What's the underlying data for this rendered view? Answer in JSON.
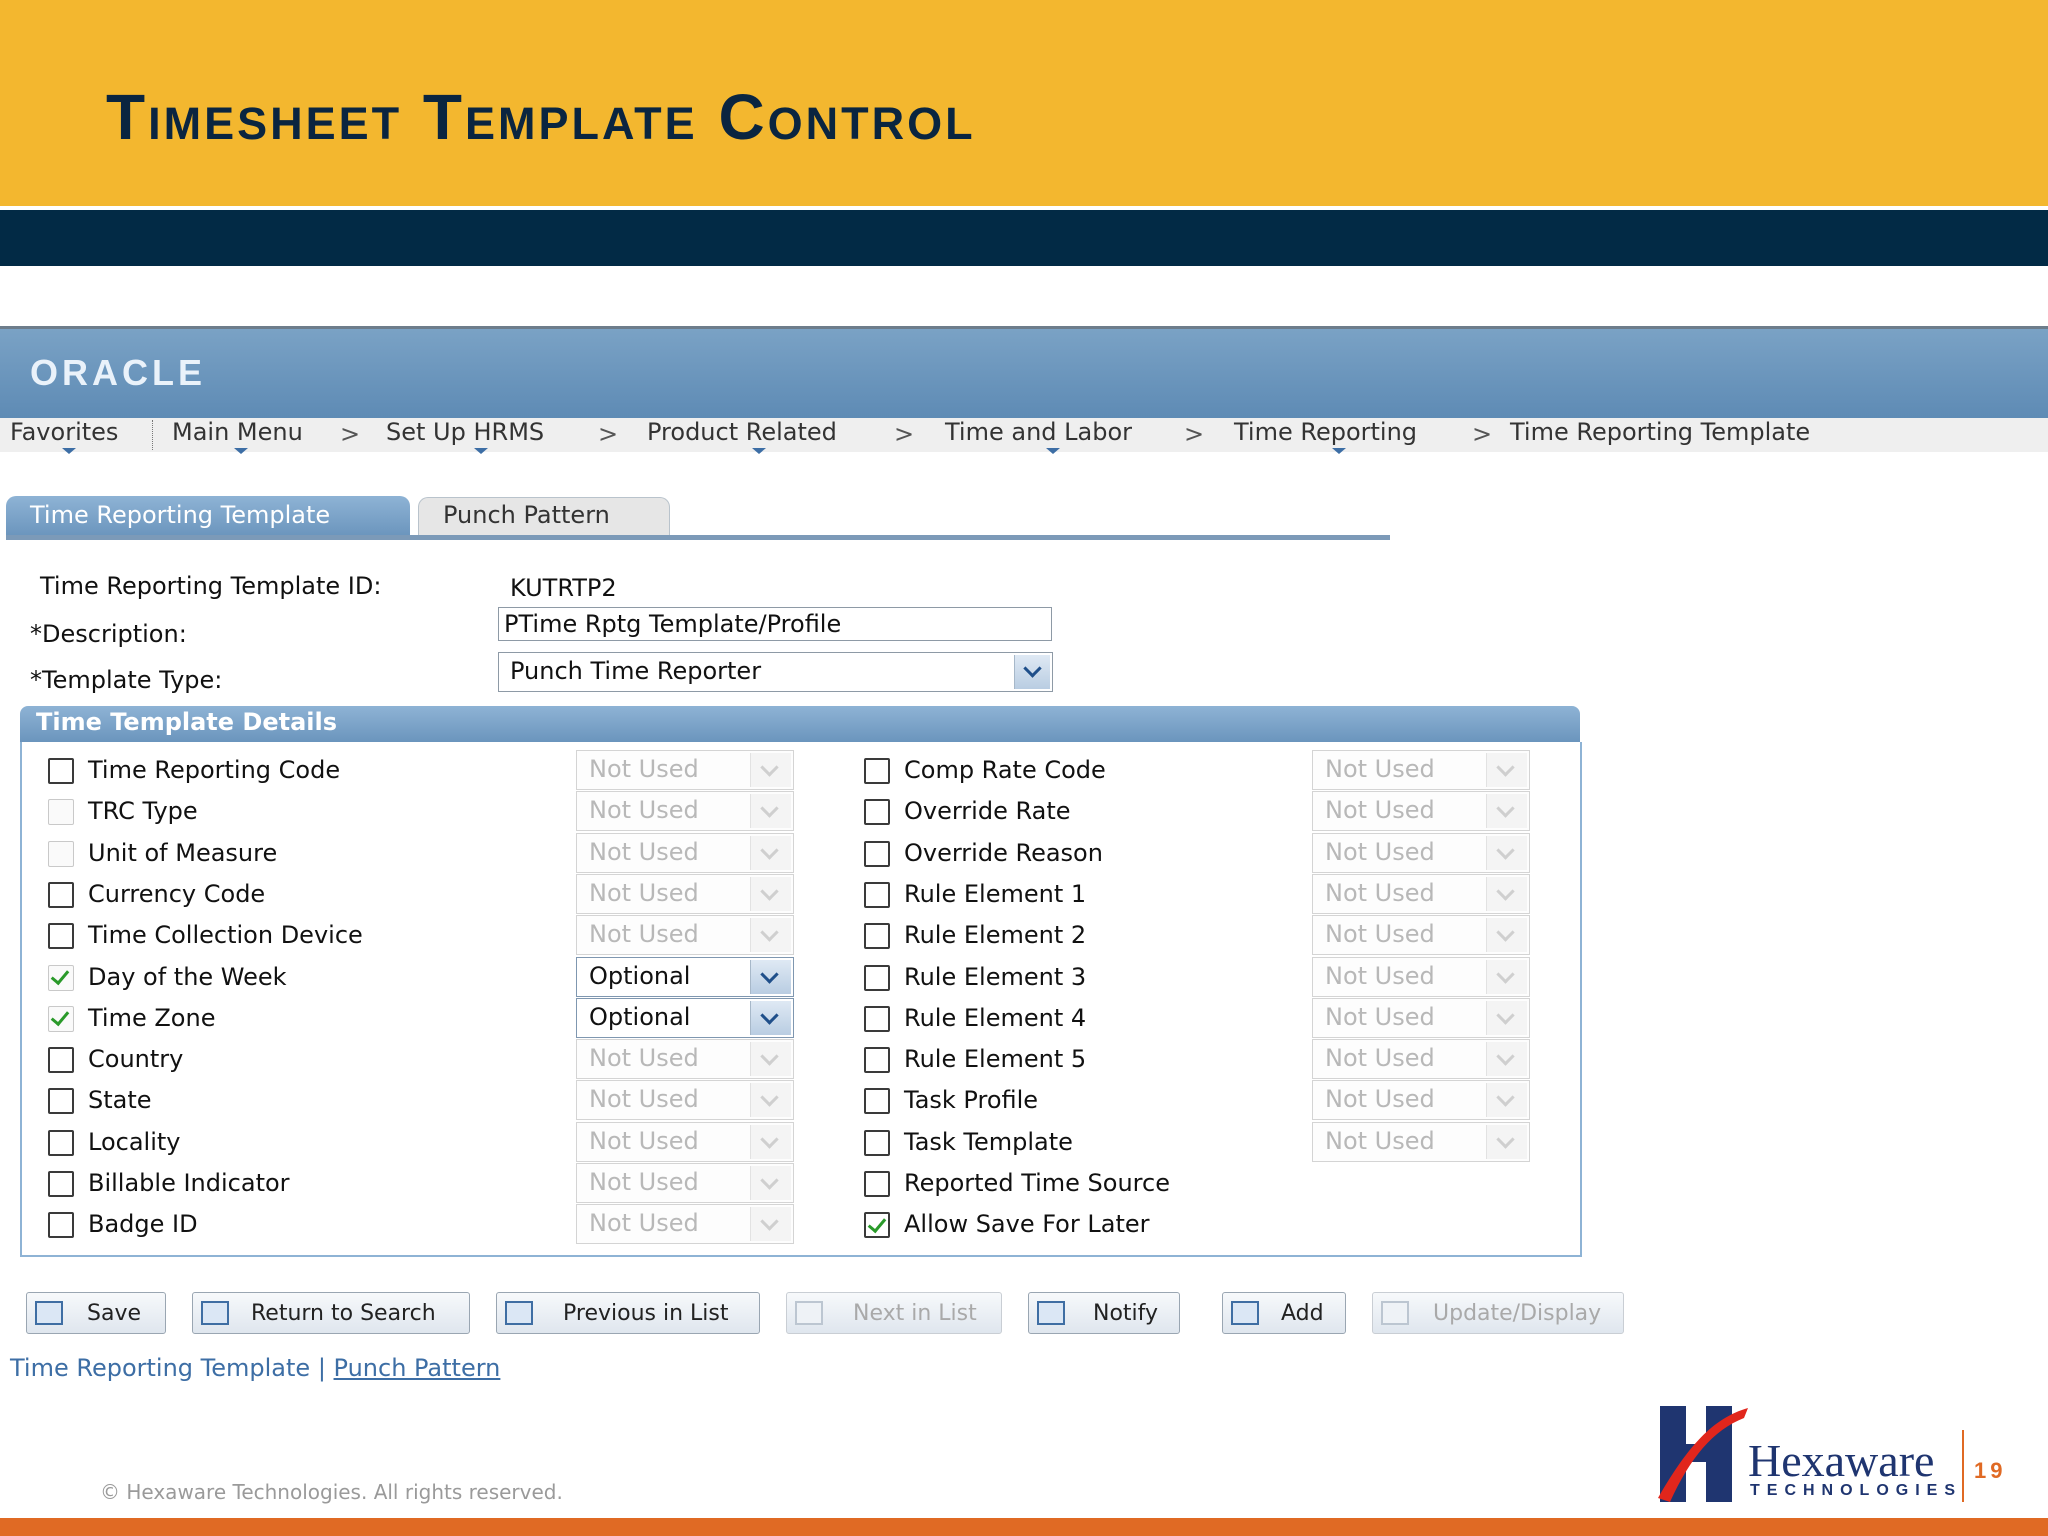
{
  "slide": {
    "title": "Timesheet Template Control",
    "copyright": "© Hexaware Technologies. All rights reserved.",
    "page_number": "19",
    "logo_name": "Hexaware",
    "logo_tagline": "TECHNOLOGIES"
  },
  "oracle": {
    "logo": "ORACLE"
  },
  "nav": {
    "items": [
      "Favorites",
      "Main Menu",
      "Set Up HRMS",
      "Product Related",
      "Time and Labor",
      "Time Reporting",
      "Time Reporting Template"
    ],
    "separator": ">"
  },
  "tabs": [
    {
      "label": "Time Reporting Template",
      "active": true
    },
    {
      "label": "Punch Pattern",
      "active": false
    }
  ],
  "form": {
    "id_label": "Time Reporting Template ID:",
    "id_value": "KUTRTP2",
    "description_label": "*Description:",
    "description_value": "PTime Rptg Template/Profile",
    "type_label": "*Template Type:",
    "type_value": "Punch Time Reporter"
  },
  "details": {
    "title": "Time Template Details",
    "left": [
      {
        "label": "Time Reporting Code",
        "checked": false,
        "disabled": false,
        "value": "Not Used",
        "enabled": false
      },
      {
        "label": "TRC Type",
        "checked": false,
        "disabled": true,
        "value": "Not Used",
        "enabled": false
      },
      {
        "label": "Unit of Measure",
        "checked": false,
        "disabled": true,
        "value": "Not Used",
        "enabled": false
      },
      {
        "label": "Currency Code",
        "checked": false,
        "disabled": false,
        "value": "Not Used",
        "enabled": false
      },
      {
        "label": "Time Collection Device",
        "checked": false,
        "disabled": false,
        "value": "Not Used",
        "enabled": false
      },
      {
        "label": "Day of the Week",
        "checked": true,
        "disabled": true,
        "value": "Optional",
        "enabled": true
      },
      {
        "label": "Time Zone",
        "checked": true,
        "disabled": true,
        "value": "Optional",
        "enabled": true
      },
      {
        "label": "Country",
        "checked": false,
        "disabled": false,
        "value": "Not Used",
        "enabled": false
      },
      {
        "label": "State",
        "checked": false,
        "disabled": false,
        "value": "Not Used",
        "enabled": false
      },
      {
        "label": "Locality",
        "checked": false,
        "disabled": false,
        "value": "Not Used",
        "enabled": false
      },
      {
        "label": "Billable Indicator",
        "checked": false,
        "disabled": false,
        "value": "Not Used",
        "enabled": false
      },
      {
        "label": "Badge ID",
        "checked": false,
        "disabled": false,
        "value": "Not Used",
        "enabled": false
      }
    ],
    "right": [
      {
        "label": "Comp Rate Code",
        "checked": false,
        "value": "Not Used"
      },
      {
        "label": "Override Rate",
        "checked": false,
        "value": "Not Used"
      },
      {
        "label": "Override Reason",
        "checked": false,
        "value": "Not Used"
      },
      {
        "label": "Rule Element 1",
        "checked": false,
        "value": "Not Used"
      },
      {
        "label": "Rule Element 2",
        "checked": false,
        "value": "Not Used"
      },
      {
        "label": "Rule Element 3",
        "checked": false,
        "value": "Not Used"
      },
      {
        "label": "Rule Element 4",
        "checked": false,
        "value": "Not Used"
      },
      {
        "label": "Rule Element 5",
        "checked": false,
        "value": "Not Used"
      },
      {
        "label": "Task Profile",
        "checked": false,
        "value": "Not Used"
      },
      {
        "label": "Task Template",
        "checked": false,
        "value": "Not Used"
      },
      {
        "label": "Reported Time Source",
        "checked": false,
        "value": null
      },
      {
        "label": "Allow Save For Later",
        "checked": true,
        "value": null
      }
    ]
  },
  "toolbar": [
    {
      "label": "Save",
      "disabled": false,
      "icon": "save-icon"
    },
    {
      "label": "Return to Search",
      "disabled": false,
      "icon": "search-icon"
    },
    {
      "label": "Previous in List",
      "disabled": false,
      "icon": "previous-list-icon"
    },
    {
      "label": "Next in List",
      "disabled": true,
      "icon": "next-list-icon"
    },
    {
      "label": "Notify",
      "disabled": false,
      "icon": "notify-icon"
    },
    {
      "label": "Add",
      "disabled": false,
      "icon": "add-icon"
    },
    {
      "label": "Update/Display",
      "disabled": true,
      "icon": "update-display-icon"
    }
  ],
  "bottom_links": {
    "link1": "Time Reporting Template",
    "separator": " | ",
    "link2": "Punch Pattern"
  },
  "colors": {
    "header_gold": "#f3b72f",
    "header_navy": "#022a45",
    "oracle_blue": "#6b95bd",
    "footer_orange": "#e06a24"
  }
}
